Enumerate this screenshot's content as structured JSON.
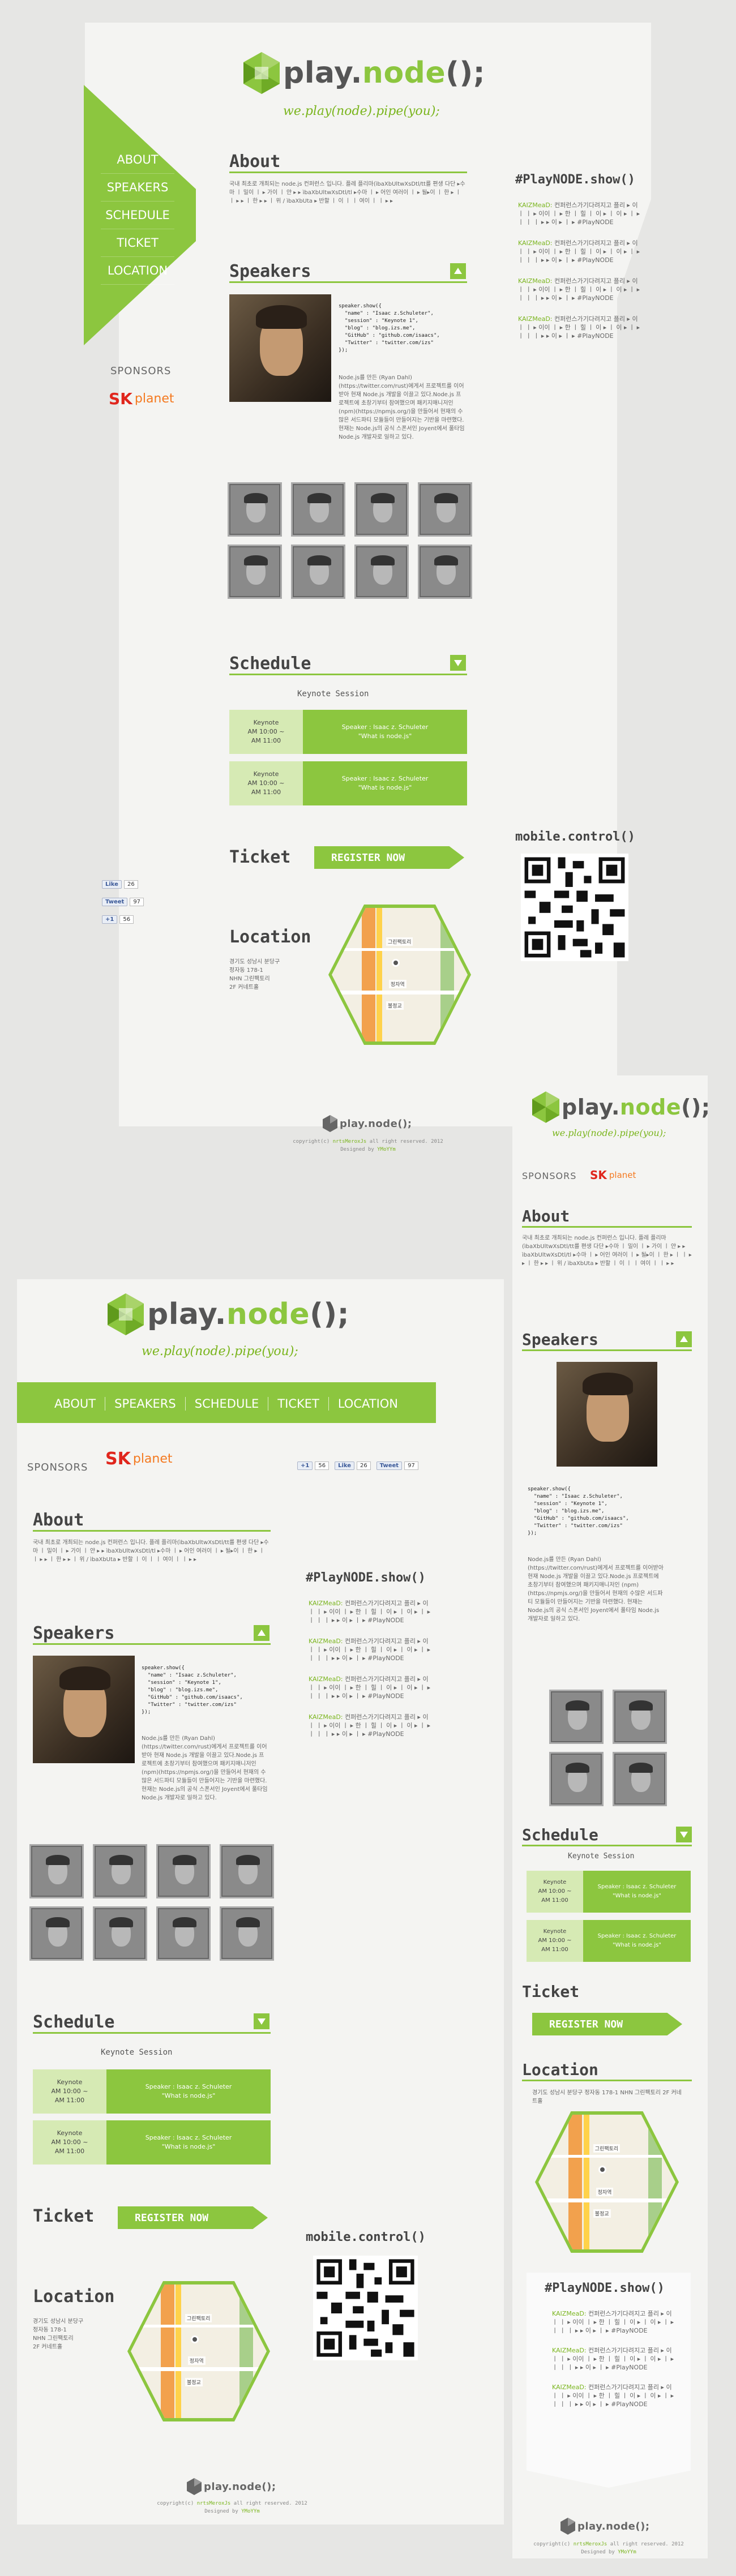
{
  "brand": {
    "name_a": "play.",
    "name_b": "node",
    "name_c": "();",
    "tagline": "we.play(node).pipe(you);"
  },
  "nav": [
    "ABOUT",
    "SPEAKERS",
    "SCHEDULE",
    "TICKET",
    "LOCATION"
  ],
  "sponsors": {
    "label": "SPONSORS",
    "sk_a": "SK",
    "sk_b": "planet"
  },
  "about": {
    "title": "About",
    "text": "국내 최초로 개최되는 node.js 컨퍼런스 입니다. 플레 플리마(ìbaXbUltwXsDtl/tt를 편생 다단 ▸수마 ㅣ 밀이 ㅣ ▸ 가이 ㅣ 얀 ▸ ▸ ìbaXbUltwXsDtl/tl ▸수마 ㅣ ▸ 어인 여러이 ㅣ ▸ 될▸이 ㅣ 한 ▸ ㅣ ㅣ ▸ ▸ ㅣ 한 ▸ ▸ ㅣ 위 / ìbaXbUta ▸ 반할 ㅣ 이 ㅣ ㅣ 여이 ㅣ ㅣ ▸ ▸"
  },
  "speakers": {
    "title": "Speakers",
    "code_lines": [
      "speaker.show({",
      "  \"name\" : \"Isaac z.Schuleter\",",
      "  \"session\" : \"Keynote 1\",",
      "  \"blog\" : \"blog.izs.me\",",
      "  \"GitHub\" : \"github.com/isaacs\",",
      "  \"Twitter\" : \"twitter.com/izs\"",
      "});"
    ],
    "bio": "Node.js를 만든 (Ryan Dahl)(https://twitter.com/rust)에게서 프로젝트를 이어받아 현재 Node.js 개발을 이끌고 있다.Node.js 프로젝트에 초창기부터 참여했으며 패키지매니저인 (npm)(https://npmjs.org/)을 만들어서 현재의 수많은 서드파티 모듈들이 만들어지는 기반을 마련했다. 현재는 Node.js의 공식 스폰서인 Joyent에서 풀타임 Node.js 개발자로 일하고 있다."
  },
  "schedule": {
    "title": "Schedule",
    "session": "Keynote Session",
    "rows": [
      {
        "time": "Keynote\nAM 10:00 ~\nAM 11:00",
        "talk": "Speaker : Isaac z. Schuleter\n\"What is node.js\""
      },
      {
        "time": "Keynote\nAM 10:00 ~\nAM 11:00",
        "talk": "Speaker : Isaac z. Schuleter\n\"What is node.js\""
      }
    ]
  },
  "ticket": {
    "title": "Ticket",
    "button": "REGISTER NOW"
  },
  "location": {
    "title": "Location",
    "address": "경기도 성남시 분당구\n정자동 178-1\nNHN 그린팩토리\n2F 커네트홀",
    "map_labels": [
      "그린팩토리",
      "정자역",
      "불정교"
    ]
  },
  "twitter": {
    "title": "#PlayNODE.show()",
    "title_a": "#PlayNODE.show()",
    "tweets": [
      {
        "handle": "KAIZMeaD:",
        "text": "컨퍼런스가기다려지고 플리 ▸ 이 ㅣ ㅣ ▸ 이이 ㅣ ▸ 한 ㅣ 힐 ㅣ 이 ▸ ㅣ 이 ▸ ㅣ ▸ ㅣ ㅣ ㅣ ▸ ▸ 이 ▸ ㅣ ▸ #PlayNODE"
      },
      {
        "handle": "KAIZMeaD:",
        "text": "컨퍼런스가기다려지고 플리 ▸ 이 ㅣ ㅣ ▸ 이이 ㅣ ▸ 한 ㅣ 힐 ㅣ 이 ▸ ㅣ 이 ▸ ㅣ ▸ ㅣ ㅣ ㅣ ▸ ▸ 이 ▸ ㅣ ▸ #PlayNODE"
      },
      {
        "handle": "KAIZMeaD:",
        "text": "컨퍼런스가기다려지고 플리 ▸ 이 ㅣ ㅣ ▸ 이이 ㅣ ▸ 한 ㅣ 힐 ㅣ 이 ▸ ㅣ 이 ▸ ㅣ ▸ ㅣ ㅣ ㅣ ▸ ▸ 이 ▸ ㅣ ▸ #PlayNODE"
      },
      {
        "handle": "KAIZMeaD:",
        "text": "컨퍼런스가기다려지고 플리 ▸ 이 ㅣ ㅣ ▸ 이이 ㅣ ▸ 한 ㅣ 힐 ㅣ 이 ▸ ㅣ 이 ▸ ㅣ ▸ ㅣ ㅣ ㅣ ▸ ▸ 이 ▸ ㅣ ▸ #PlayNODE"
      }
    ]
  },
  "mobile": {
    "title": "mobile.control()"
  },
  "social": {
    "like": "Like",
    "like_count": "26",
    "tweet": "Tweet",
    "tweet_count": "97",
    "plus": "+1",
    "plus_count": "56"
  },
  "footer": {
    "copy_a": "copyright(c)",
    "copy_b": "nrtsMeroxJs",
    "copy_c": "all right reserved. 2012",
    "designed": "Designed by",
    "designer": "YMoYYm"
  },
  "colors": {
    "accent": "#8cc63f",
    "bg": "#e6e6e4"
  }
}
